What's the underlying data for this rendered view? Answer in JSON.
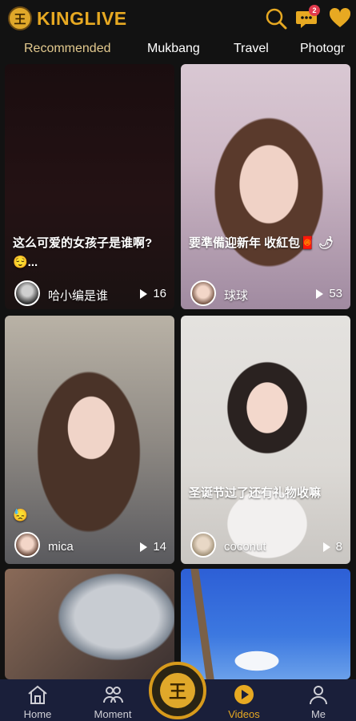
{
  "header": {
    "logo_text": "KINGLIVE",
    "logo_glyph": "王",
    "search_icon": "search-icon",
    "message_icon": "chat-bubble-icon",
    "message_badge": "2",
    "favorites_icon": "heart-icon",
    "accent": "#e7a922"
  },
  "tabs": [
    {
      "label": "Recommended"
    },
    {
      "label": "Mukbang"
    },
    {
      "label": "Travel"
    },
    {
      "label": "Photogr"
    }
  ],
  "cards": [
    {
      "caption": "这么可爱的女孩子是谁啊? 😌...",
      "user": "哈小编是谁",
      "views": "16"
    },
    {
      "caption": "要準備迎新年 收紅包🧧 🌶",
      "user": "球球",
      "views": "53"
    },
    {
      "caption": "😓",
      "user": "mica",
      "views": "14"
    },
    {
      "caption": "圣诞节过了还有礼物收嘛",
      "user": "coconut",
      "views": "8"
    },
    {
      "caption": "",
      "user": "",
      "views": ""
    },
    {
      "caption": "",
      "user": "",
      "views": ""
    }
  ],
  "bottom_nav": [
    {
      "label": "Home",
      "icon": "home-icon"
    },
    {
      "label": "Moment",
      "icon": "people-icon"
    },
    {
      "label": "",
      "icon": "king-logo-icon"
    },
    {
      "label": "Videos",
      "icon": "play-circle-icon"
    },
    {
      "label": "Me",
      "icon": "person-icon"
    }
  ],
  "fab_glyph": "王"
}
